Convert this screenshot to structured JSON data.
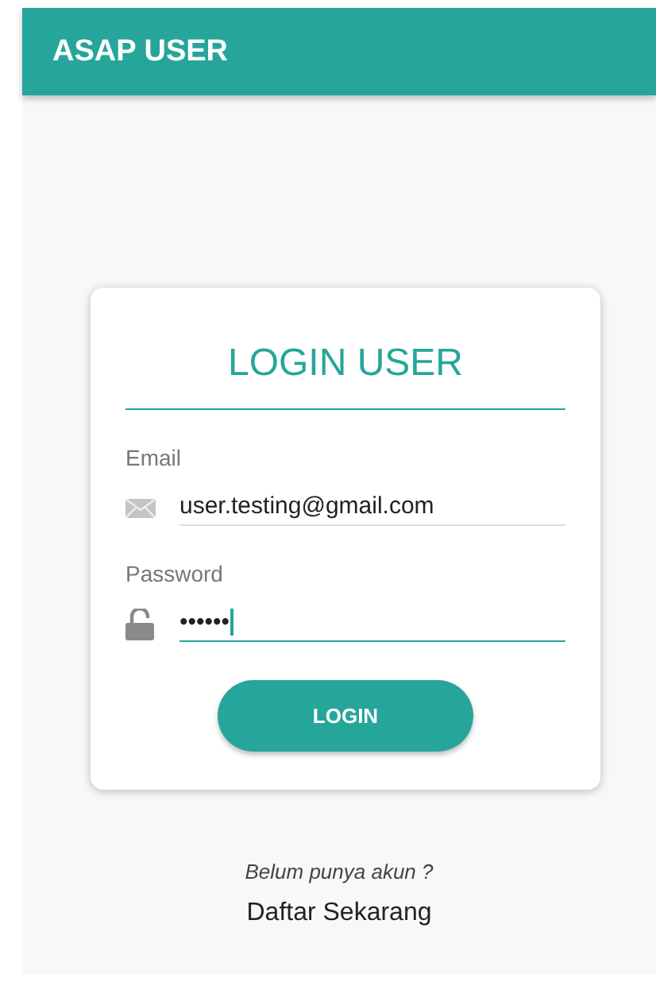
{
  "app_bar": {
    "title": "ASAP USER"
  },
  "card": {
    "title": "LOGIN USER",
    "fields": [
      {
        "kind": "email",
        "label": "Email",
        "value": "user.testing@gmail.com",
        "focused": false
      },
      {
        "kind": "password",
        "label": "Password",
        "value": "••••••",
        "focused": true
      }
    ],
    "button": "LOGIN"
  },
  "footer": {
    "prompt": "Belum punya akun ?",
    "link": "Daftar Sekarang"
  }
}
